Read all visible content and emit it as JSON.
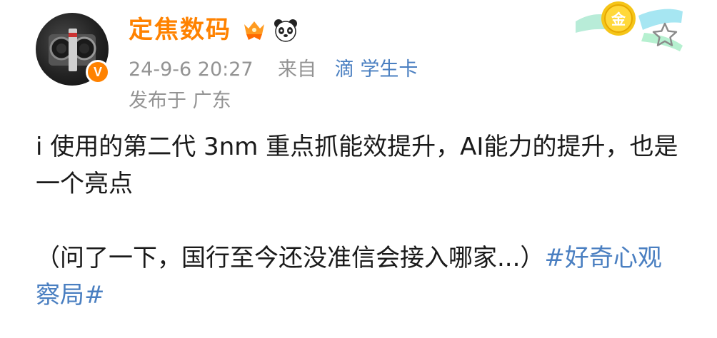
{
  "user": {
    "name": "定焦数码",
    "verified_mark": "V"
  },
  "icons": {
    "avatar": "camera-photo-avatar",
    "verified": "verified-badge-icon",
    "fan_badge": "orange-crown-badge-icon",
    "panda": "panda-icon",
    "gold_medal": "gold-medal-badge-icon",
    "favorite": "star-icon"
  },
  "gold_badge_text": "金",
  "meta": {
    "timestamp": "24-9-6 20:27",
    "from_label": "来自",
    "source": "滴 学生卡",
    "location": "发布于 广东"
  },
  "post": {
    "line1": "i 使用的第二代 3nm 重点抓能效提升，AI能力的提升，也是一个亮点",
    "line2_text": "（问了一下，国行至今还没准信会接入哪家...）",
    "topic": "#好奇心观察局#"
  },
  "colors": {
    "username": "#ff8200",
    "link": "#4a7fc1",
    "meta": "#939393"
  }
}
